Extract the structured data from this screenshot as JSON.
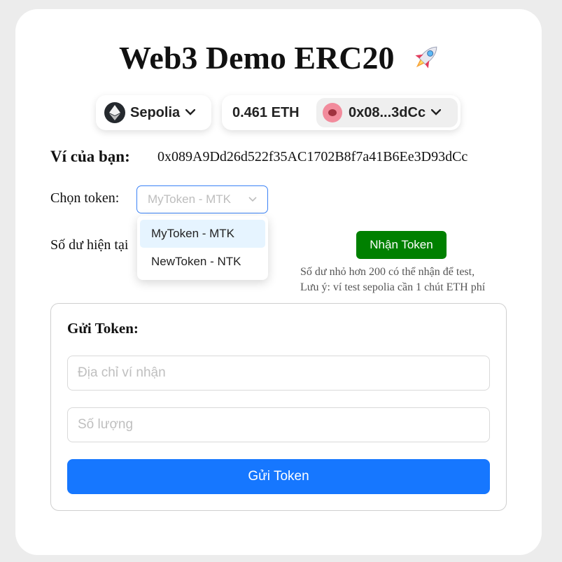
{
  "app": {
    "title": "Web3 Demo ERC20",
    "title_icon": "rocket-icon"
  },
  "network": {
    "name": "Sepolia",
    "icon": "ethereum-icon"
  },
  "account": {
    "balance": "0.461 ETH",
    "short_address": "0x08...3dCc",
    "avatar_color": "#f28b9c"
  },
  "wallet": {
    "label": "Ví của bạn:",
    "address": "0x089A9Dd26d522f35AC1702B8f7a41B6Ee3D93dCc"
  },
  "token_select": {
    "label": "Chọn token:",
    "selected": "MyToken - MTK",
    "options": [
      "MyToken - MTK",
      "NewToken - NTK"
    ]
  },
  "balance": {
    "label": "Số dư hiện tại"
  },
  "claim": {
    "button_label": "Nhận Token",
    "note_line1": "Số dư nhỏ hơn 200 có thể nhận để test,",
    "note_line2": "Lưu ý: ví test sepolia cần 1 chút ETH phí"
  },
  "send": {
    "title": "Gửi Token:",
    "address_placeholder": "Địa chỉ ví nhận",
    "amount_placeholder": "Số lượng",
    "button_label": "Gửi Token"
  },
  "colors": {
    "primary": "#1677ff",
    "claim_green": "#008000",
    "select_border": "#3b82f6",
    "option_active_bg": "#e6f4ff"
  }
}
